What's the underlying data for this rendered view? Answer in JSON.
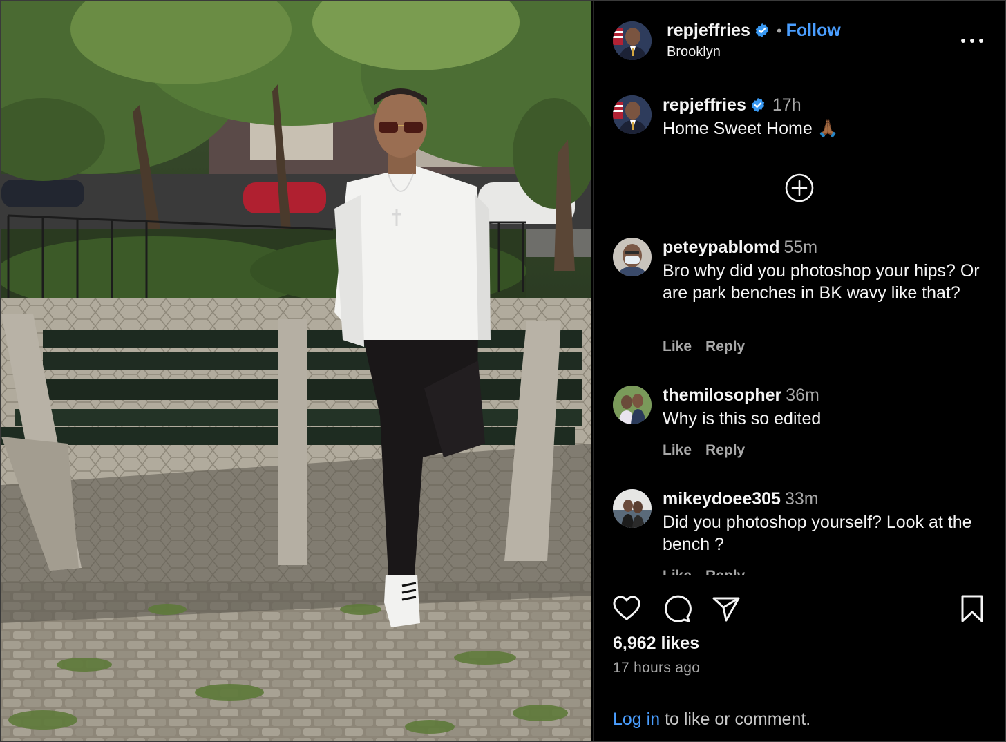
{
  "post": {
    "photo_alt": "man in white shirt leaning on park bench"
  },
  "header": {
    "username": "repjeffries",
    "separator": "•",
    "follow_label": "Follow",
    "location": "Brooklyn"
  },
  "caption": {
    "username": "repjeffries",
    "time": "17h",
    "text": "Home Sweet Home 🙏🏾"
  },
  "comments": [
    {
      "username": "peteypablomd",
      "time": "55m",
      "text": "Bro why did you photoshop your hips? Or are park benches in BK wavy like that?",
      "like_label": "Like",
      "reply_label": "Reply"
    },
    {
      "username": "themilosopher",
      "time": "36m",
      "text": "Why is this so edited",
      "like_label": "Like",
      "reply_label": "Reply"
    },
    {
      "username": "mikeydoee305",
      "time": "33m",
      "text": "Did you photoshop yourself? Look at the bench ?",
      "like_label": "Like",
      "reply_label": "Reply"
    }
  ],
  "footer": {
    "likes": "6,962 likes",
    "time_ago": "17 hours ago",
    "login_link": "Log in",
    "login_rest": " to like or comment."
  },
  "colors": {
    "background": "#000000",
    "link_blue": "#4a9eff",
    "verified_blue": "#3897f0",
    "muted_text": "#a8a8a8"
  },
  "icons": [
    "verified-badge-icon",
    "more-options-icon",
    "load-more-comments-icon",
    "heart-icon",
    "comment-icon",
    "share-icon",
    "bookmark-icon"
  ]
}
